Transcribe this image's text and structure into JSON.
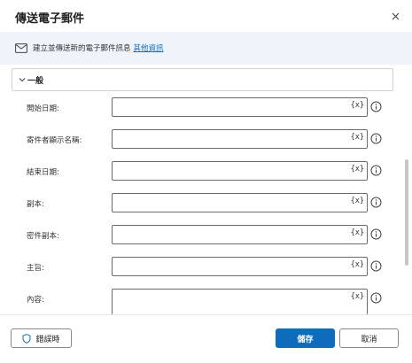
{
  "dialog": {
    "title": "傳送電子郵件",
    "close_icon": "close-icon"
  },
  "infobar": {
    "message": "建立並傳送新的電子郵件訊息",
    "link": "其他資訊",
    "icon": "mail-icon"
  },
  "section": {
    "label": "一般",
    "icon": "chevron-down-icon"
  },
  "fields": [
    {
      "label": "開始日期:",
      "value": "",
      "var_button": "{x}"
    },
    {
      "label": "寄件者顯示名稱:",
      "value": "",
      "var_button": "{x}"
    },
    {
      "label": "結束日期:",
      "value": "",
      "var_button": "{x}"
    },
    {
      "label": "副本:",
      "value": "",
      "var_button": "{x}"
    },
    {
      "label": "密件副本:",
      "value": "",
      "var_button": "{x}"
    },
    {
      "label": "主旨:",
      "value": "",
      "var_button": "{x}"
    },
    {
      "label": "內容:",
      "value": "",
      "var_button": "{x}"
    }
  ],
  "footer": {
    "error_button": "錯誤時",
    "save_button": "儲存",
    "cancel_button": "取消"
  },
  "colors": {
    "accent": "#0f6cbd",
    "infobar_bg": "#eff4fb"
  }
}
